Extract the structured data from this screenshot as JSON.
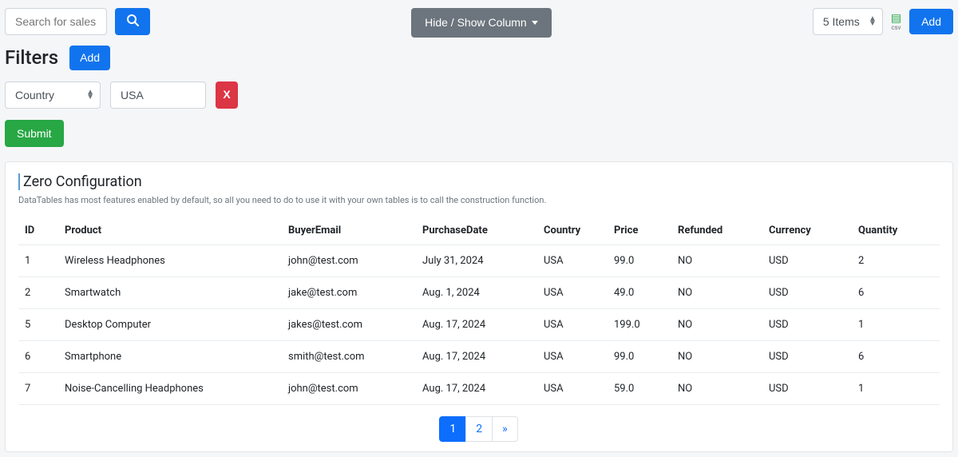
{
  "toolbar": {
    "search_placeholder": "Search for sales",
    "hide_show_label": "Hide / Show Column",
    "items_select": "5 Items",
    "csv_label": "csv",
    "add_label": "Add"
  },
  "filters": {
    "heading": "Filters",
    "add_label": "Add",
    "rows": [
      {
        "field": "Country",
        "value": "USA"
      }
    ],
    "remove_label": "X",
    "submit_label": "Submit"
  },
  "card": {
    "title": "Zero Configuration",
    "desc": "DataTables has most features enabled by default, so all you need to do to use it with your own tables is to call the construction function."
  },
  "table": {
    "headers": {
      "id": "ID",
      "product": "Product",
      "email": "BuyerEmail",
      "date": "PurchaseDate",
      "country": "Country",
      "price": "Price",
      "refunded": "Refunded",
      "currency": "Currency",
      "quantity": "Quantity"
    },
    "rows": [
      {
        "id": "1",
        "product": "Wireless Headphones",
        "email": "john@test.com",
        "date": "July 31, 2024",
        "country": "USA",
        "price": "99.0",
        "refunded": "NO",
        "currency": "USD",
        "quantity": "2"
      },
      {
        "id": "2",
        "product": "Smartwatch",
        "email": "jake@test.com",
        "date": "Aug. 1, 2024",
        "country": "USA",
        "price": "49.0",
        "refunded": "NO",
        "currency": "USD",
        "quantity": "6"
      },
      {
        "id": "5",
        "product": "Desktop Computer",
        "email": "jakes@test.com",
        "date": "Aug. 17, 2024",
        "country": "USA",
        "price": "199.0",
        "refunded": "NO",
        "currency": "USD",
        "quantity": "1"
      },
      {
        "id": "6",
        "product": "Smartphone",
        "email": "smith@test.com",
        "date": "Aug. 17, 2024",
        "country": "USA",
        "price": "99.0",
        "refunded": "NO",
        "currency": "USD",
        "quantity": "6"
      },
      {
        "id": "7",
        "product": "Noise-Cancelling Headphones",
        "email": "john@test.com",
        "date": "Aug. 17, 2024",
        "country": "USA",
        "price": "59.0",
        "refunded": "NO",
        "currency": "USD",
        "quantity": "1"
      }
    ]
  },
  "pagination": {
    "pages": [
      "1",
      "2"
    ],
    "active": "1",
    "next_label": "»"
  }
}
